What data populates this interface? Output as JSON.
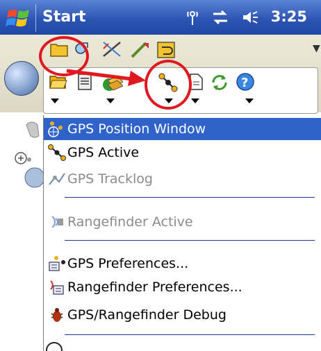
{
  "titlebar": {
    "title": "Start",
    "time": "3:25",
    "icons": [
      "windows-flag-icon",
      "signal-icon",
      "connectivity-icon",
      "volume-icon"
    ]
  },
  "toolbar": {
    "buttons": [
      "folder-icon",
      "find-icon",
      "measure-icon",
      "draw-icon",
      "undo-icon"
    ],
    "dropdown_buttons": [
      "open-folder-icon",
      "document-icon",
      "layers-icon",
      "gps-icon",
      "page-icon",
      "refresh-icon",
      "help-icon"
    ]
  },
  "menu": {
    "items": [
      {
        "label": "GPS Position Window",
        "state": "selected",
        "icon": "gps-position-icon"
      },
      {
        "label": "GPS Active",
        "state": "normal",
        "icon": "gps-active-icon"
      },
      {
        "label": "GPS Tracklog",
        "state": "disabled",
        "icon": "gps-tracklog-icon"
      },
      {
        "label": "Rangefinder Active",
        "state": "disabled",
        "icon": "rangefinder-icon"
      },
      {
        "label": "GPS Preferences...",
        "state": "normal",
        "icon": "gps-preferences-icon"
      },
      {
        "label": "Rangefinder Preferences...",
        "state": "normal",
        "icon": "rangefinder-preferences-icon"
      },
      {
        "label": "GPS/Rangefinder Debug",
        "state": "normal",
        "icon": "bug-icon"
      }
    ]
  },
  "colors": {
    "titlebar": "#2d55b3",
    "selection": "#2f63c9",
    "annotation": "#e0181f",
    "separator": "#1a3f8f"
  }
}
